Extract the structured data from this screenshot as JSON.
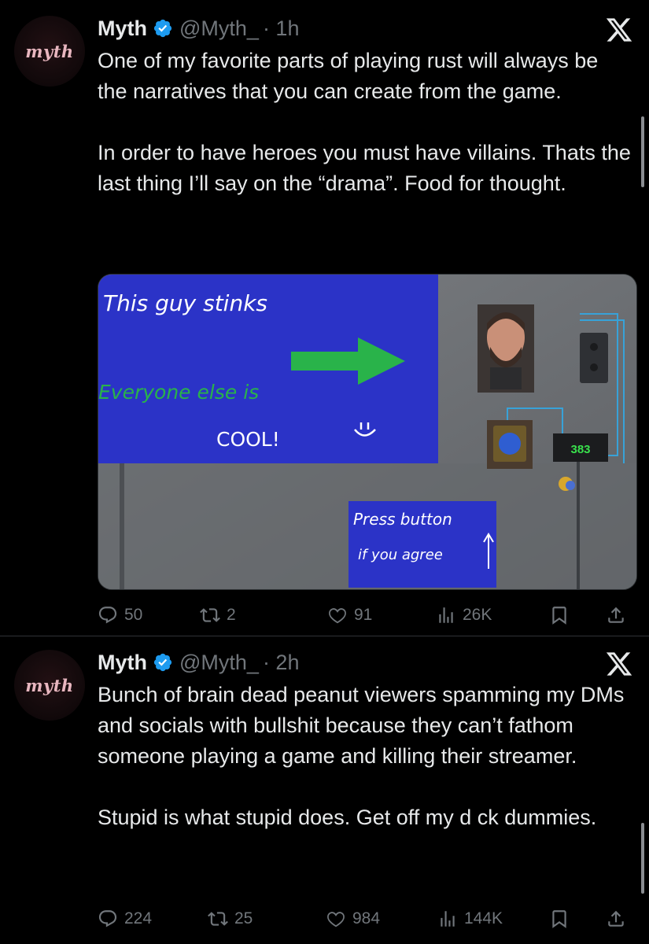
{
  "tweets": [
    {
      "avatar_text": "myth",
      "name": "Myth",
      "handle": "@Myth_",
      "time": "· 1h",
      "text": [
        "One of my favorite parts of playing rust will always be the narratives that you can create from the game.",
        "In order to have heroes you must have villains. Thats the last thing I’ll say on the “drama”. Food for thought."
      ],
      "media": {
        "sign_line1": "This guy stinks",
        "sign_line2": "Everyone else is",
        "sign_line3": "COOL!",
        "small_sign_line1": "Press button",
        "small_sign_line2": "if you agree",
        "counter": "383"
      },
      "stats": {
        "replies": "50",
        "reposts": "2",
        "likes": "91",
        "views": "26K"
      }
    },
    {
      "avatar_text": "myth",
      "name": "Myth",
      "handle": "@Myth_",
      "time": "· 2h",
      "text": [
        "Bunch of brain dead peanut viewers spamming my DMs and socials with bullshit because they can’t fathom someone playing a game and killing their streamer.",
        "Stupid is what stupid does. Get off my d ck dummies."
      ],
      "stats": {
        "replies": "224",
        "reposts": "25",
        "likes": "984",
        "views": "144K"
      }
    }
  ],
  "colors": {
    "background": "#000000",
    "text": "#e7e9ea",
    "muted": "#71767b",
    "verified": "#1d9bf0",
    "divider": "#2f3336"
  },
  "icons": [
    "verified-badge-icon",
    "x-logo-icon",
    "reply-icon",
    "repost-icon",
    "like-icon",
    "views-icon",
    "bookmark-icon",
    "share-icon"
  ]
}
